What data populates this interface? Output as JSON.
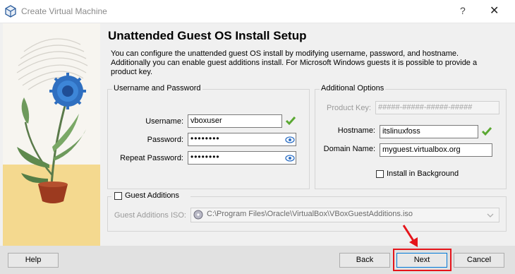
{
  "window": {
    "title": "Create Virtual Machine",
    "help_glyph": "?",
    "close_glyph": "✕",
    "app_icon": "virtualbox-icon"
  },
  "page": {
    "heading": "Unattended Guest OS Install Setup",
    "description": "You can configure the unattended guest OS install by modifying username, password, and hostname. Additionally you can enable guest additions install. For Microsoft Windows guests it is possible to provide a product key."
  },
  "user_group": {
    "title": "Username and Password",
    "username_label": "Username:",
    "username_value": "vboxuser",
    "password_label": "Password:",
    "password_value": "••••••••",
    "repeat_label": "Repeat Password:",
    "repeat_value": "••••••••"
  },
  "options_group": {
    "title": "Additional Options",
    "product_key_label": "Product Key:",
    "product_key_placeholder": "#####-#####-#####-#####",
    "hostname_label": "Hostname:",
    "hostname_value": "itslinuxfoss",
    "domain_label": "Domain Name:",
    "domain_value": "myguest.virtualbox.org",
    "install_bg_label": "Install in Background",
    "install_bg_checked": false
  },
  "guest_additions": {
    "label": "Guest Additions",
    "checked": false,
    "iso_label": "Guest Additions ISO:",
    "iso_value": "C:\\Program Files\\Oracle\\VirtualBox\\VBoxGuestAdditions.iso"
  },
  "buttons": {
    "help": "Help",
    "back": "Back",
    "next": "Next",
    "cancel": "Cancel"
  },
  "colors": {
    "valid_check": "#5aa832",
    "highlight": "#e5141a",
    "focus_border": "#0078d7"
  }
}
